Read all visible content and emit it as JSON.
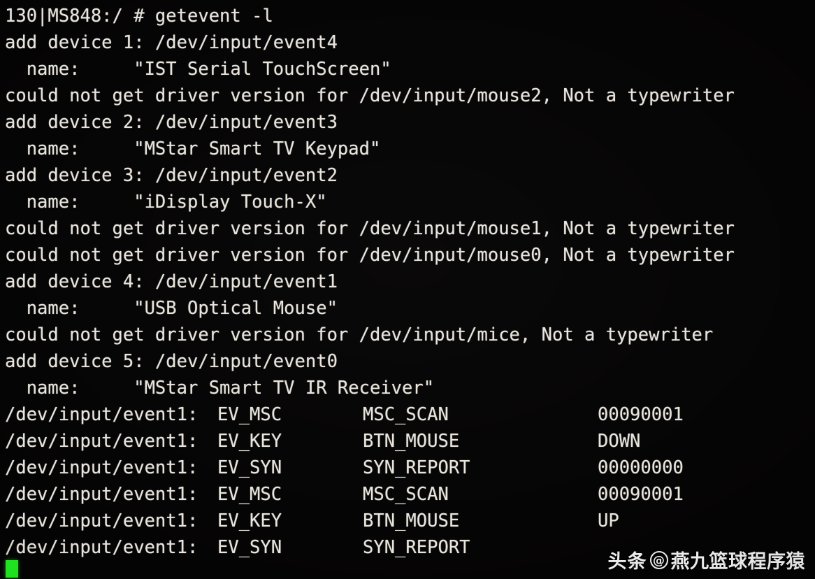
{
  "terminal": {
    "theme": {
      "background": "#050404",
      "foreground": "#e9e5dd",
      "cursor_color": "#22ee22"
    },
    "prompt_line": "130|MS848:/ # getevent -l",
    "command": "getevent -l",
    "lines": [
      "130|MS848:/ # getevent -l",
      "add device 1: /dev/input/event4",
      "  name:     \"IST Serial TouchScreen\"",
      "could not get driver version for /dev/input/mouse2, Not a typewriter",
      "add device 2: /dev/input/event3",
      "  name:     \"MStar Smart TV Keypad\"",
      "add device 3: /dev/input/event2",
      "  name:     \"iDisplay Touch-X\"",
      "could not get driver version for /dev/input/mouse1, Not a typewriter",
      "could not get driver version for /dev/input/mouse0, Not a typewriter",
      "add device 4: /dev/input/event1",
      "  name:     \"USB Optical Mouse\"",
      "could not get driver version for /dev/input/mice, Not a typewriter",
      "add device 5: /dev/input/event0",
      "  name:     \"MStar Smart TV IR Receiver\""
    ],
    "devices": [
      {
        "index": "1",
        "node": "/dev/input/event4",
        "name": "\"IST Serial TouchScreen\""
      },
      {
        "index": "2",
        "node": "/dev/input/event3",
        "name": "\"MStar Smart TV Keypad\""
      },
      {
        "index": "3",
        "node": "/dev/input/event2",
        "name": "\"iDisplay Touch-X\""
      },
      {
        "index": "4",
        "node": "/dev/input/event1",
        "name": "\"USB Optical Mouse\""
      },
      {
        "index": "5",
        "node": "/dev/input/event0",
        "name": "\"MStar Smart TV IR Receiver\""
      }
    ],
    "events": [
      {
        "device": "/dev/input/event1:",
        "type": "EV_MSC",
        "code": "MSC_SCAN",
        "value": "00090001"
      },
      {
        "device": "/dev/input/event1:",
        "type": "EV_KEY",
        "code": "BTN_MOUSE",
        "value": "DOWN"
      },
      {
        "device": "/dev/input/event1:",
        "type": "EV_SYN",
        "code": "SYN_REPORT",
        "value": "00000000"
      },
      {
        "device": "/dev/input/event1:",
        "type": "EV_MSC",
        "code": "MSC_SCAN",
        "value": "00090001"
      },
      {
        "device": "/dev/input/event1:",
        "type": "EV_KEY",
        "code": "BTN_MOUSE",
        "value": "UP"
      },
      {
        "device": "/dev/input/event1:",
        "type": "EV_SYN",
        "code": "SYN_REPORT",
        "value": ""
      }
    ],
    "cursor": "block"
  },
  "watermark": {
    "brand": "头条",
    "at_symbol": "@",
    "username": "燕九篮球程序猿"
  }
}
